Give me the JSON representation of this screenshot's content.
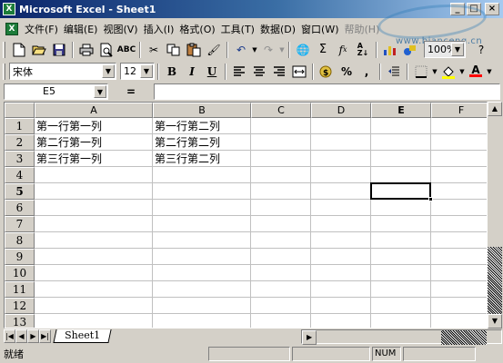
{
  "window": {
    "title": "Microsoft Excel - Sheet1",
    "app_icon": "excel-icon",
    "caption_buttons": [
      "minimize-icon",
      "maximize-icon",
      "close-icon"
    ]
  },
  "watermark": {
    "text": "www.bianceng.cn"
  },
  "menu": {
    "items": [
      {
        "label": "文件(F)"
      },
      {
        "label": "编辑(E)"
      },
      {
        "label": "视图(V)"
      },
      {
        "label": "插入(I)"
      },
      {
        "label": "格式(O)"
      },
      {
        "label": "工具(T)"
      },
      {
        "label": "数据(D)"
      },
      {
        "label": "窗口(W)"
      },
      {
        "label": "帮助(H)"
      }
    ]
  },
  "standard_toolbar": {
    "icons": [
      "new-icon",
      "open-icon",
      "save-icon",
      "print-icon",
      "print-preview-icon",
      "spelling-icon",
      "cut-icon",
      "copy-icon",
      "paste-icon",
      "format-painter-icon",
      "undo-icon",
      "redo-icon",
      "hyperlink-icon",
      "autosum-icon",
      "function-icon",
      "sort-ascending-icon",
      "chart-wizard-icon",
      "drawing-icon"
    ],
    "zoom": "100%",
    "help_icon": "help-icon"
  },
  "format_toolbar": {
    "font": "宋体",
    "size": "12",
    "bold": "B",
    "italic": "I",
    "underline": "U",
    "percent": "%",
    "comma": ","
  },
  "formula_bar": {
    "name_box": "E5",
    "equals": "=",
    "formula": ""
  },
  "sheet": {
    "columns": [
      "A",
      "B",
      "C",
      "D",
      "E",
      "F"
    ],
    "rows": [
      "1",
      "2",
      "3",
      "4",
      "5",
      "6",
      "7",
      "8",
      "9",
      "10",
      "11",
      "12",
      "13"
    ],
    "active_cell": "E5",
    "cells": {
      "A1": "第一行第一列",
      "B1": "第一行第二列",
      "A2": "第二行第一列",
      "B2": "第二行第二列",
      "A3": "第三行第一列",
      "B3": "第三行第二列"
    }
  },
  "tabs": {
    "sheets": [
      "Sheet1"
    ]
  },
  "status": {
    "text": "就绪",
    "num_indicator": "NUM"
  }
}
